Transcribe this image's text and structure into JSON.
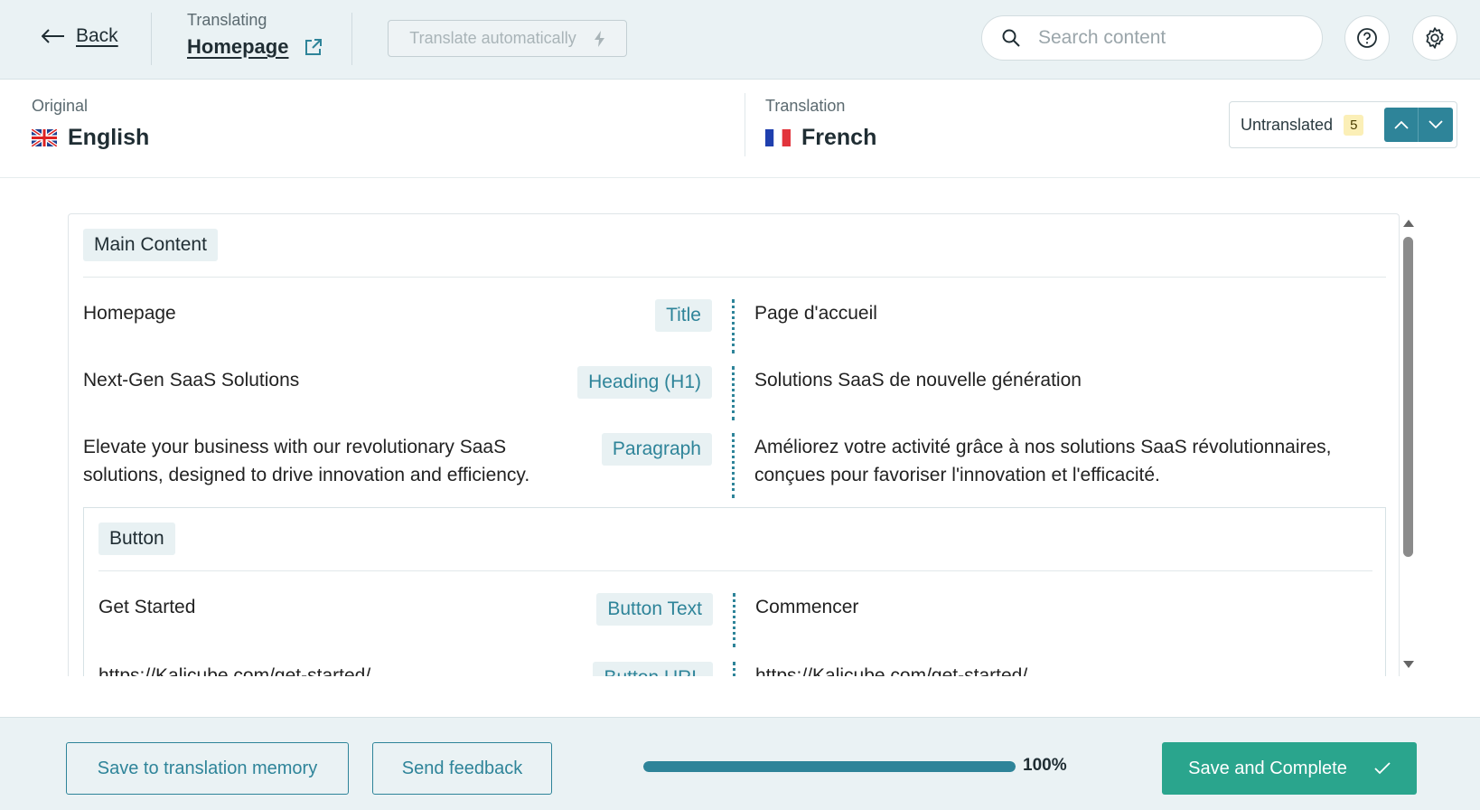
{
  "header": {
    "back_label": "Back",
    "translating_label": "Translating",
    "page_name": "Homepage",
    "auto_translate_label": "Translate automatically",
    "search_placeholder": "Search content"
  },
  "languages": {
    "original_label": "Original",
    "original_name": "English",
    "translation_label": "Translation",
    "translation_name": "French",
    "untranslated_label": "Untranslated",
    "untranslated_count": "5"
  },
  "content": {
    "section_label": "Main Content",
    "rows": [
      {
        "source": "Homepage",
        "type": "Title",
        "translation": "Page d'accueil"
      },
      {
        "source": "Next-Gen SaaS Solutions",
        "type": "Heading (H1)",
        "translation": "Solutions SaaS de nouvelle génération"
      },
      {
        "source": "Elevate your business with our revolutionary SaaS solutions, designed to drive innovation and efficiency.",
        "type": "Paragraph",
        "translation": "Améliorez votre activité grâce à nos solutions SaaS révolutionnaires, conçues pour favoriser l'innovation et l'efficacité."
      }
    ],
    "button_group": {
      "label": "Button",
      "rows": [
        {
          "source": "Get Started",
          "type": "Button Text",
          "translation": "Commencer"
        },
        {
          "source": "https://Kalicube.com/get-started/",
          "type": "Button URL",
          "translation": "https://Kalicube.com/get-started/"
        }
      ]
    }
  },
  "footer": {
    "save_memory_label": "Save to translation memory",
    "feedback_label": "Send feedback",
    "progress": 1.0,
    "progress_label": "100%",
    "complete_label": "Save and Complete"
  },
  "colors": {
    "accent": "#2e8499",
    "primary": "#2aa58d",
    "bar_bg": "#eaf2f4",
    "count_badge": "#fbefb7"
  }
}
